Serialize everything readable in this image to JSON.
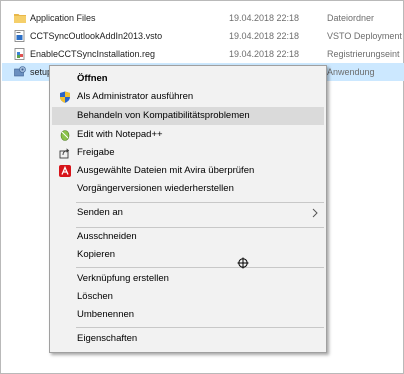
{
  "files": [
    {
      "name": "Application Files",
      "date": "19.04.2018 22:18",
      "type": "Dateiordner",
      "icon": "folder-icon"
    },
    {
      "name": "CCTSyncOutlookAddIn2013.vsto",
      "date": "19.04.2018 22:18",
      "type": "VSTO Deployment",
      "icon": "vsto-file-icon"
    },
    {
      "name": "EnableCCTSyncInstallation.reg",
      "date": "19.04.2018 22:18",
      "type": "Registrierungseint",
      "icon": "registry-file-icon"
    },
    {
      "name": "setup",
      "date": "",
      "type": "Anwendung",
      "icon": "setup-app-icon"
    }
  ],
  "context_menu": {
    "open": "Öffnen",
    "run_as_admin": "Als Administrator ausführen",
    "troubleshoot_compat": "Behandeln von Kompatibilitätsproblemen",
    "edit_notepadpp": "Edit with Notepad++",
    "share": "Freigabe",
    "avira_scan": "Ausgewählte Dateien mit Avira überprüfen",
    "restore_versions": "Vorgängerversionen wiederherstellen",
    "send_to": "Senden an",
    "cut": "Ausschneiden",
    "copy": "Kopieren",
    "create_shortcut": "Verknüpfung erstellen",
    "delete": "Löschen",
    "rename": "Umbenennen",
    "properties": "Eigenschaften"
  },
  "colors": {
    "selection": "#cce8ff",
    "menu_background": "#f2f2f2",
    "menu_hover": "#dadada",
    "avira_red": "#d7141a"
  }
}
